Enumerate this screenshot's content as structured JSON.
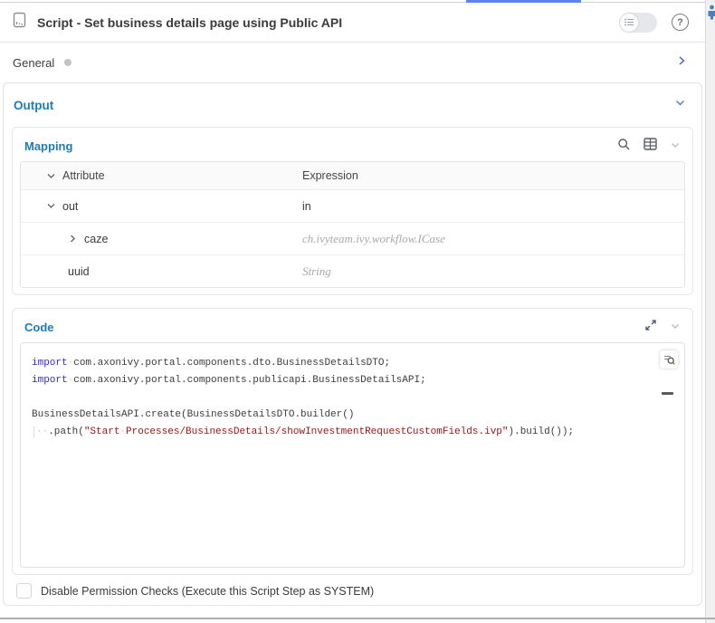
{
  "header": {
    "title": "Script - Set business details page using Public API"
  },
  "general": {
    "label": "General"
  },
  "output": {
    "label": "Output"
  },
  "mapping": {
    "label": "Mapping",
    "columns": {
      "attribute": "Attribute",
      "expression": "Expression"
    },
    "rows": [
      {
        "attribute": "out",
        "expression": "in",
        "chevron": "down",
        "level": 1,
        "placeholder": false
      },
      {
        "attribute": "caze",
        "expression": "ch.ivyteam.ivy.workflow.ICase",
        "chevron": "right",
        "level": 2,
        "placeholder": true
      },
      {
        "attribute": "uuid",
        "expression": "String",
        "chevron": "none",
        "level": 2,
        "placeholder": true
      }
    ]
  },
  "code": {
    "label": "Code",
    "lines": [
      [
        {
          "t": "import",
          "c": "kw"
        },
        {
          "t": "·",
          "c": "ws"
        },
        {
          "t": "com.axonivy.portal.components.dto.BusinessDetailsDTO;",
          "c": "pl"
        }
      ],
      [
        {
          "t": "import",
          "c": "kw"
        },
        {
          "t": "·",
          "c": "ws"
        },
        {
          "t": "com.axonivy.portal.components.publicapi.BusinessDetailsAPI;",
          "c": "pl"
        }
      ],
      [],
      [
        {
          "t": "BusinessDetailsAPI.create(BusinessDetailsDTO.builder()",
          "c": "pl"
        }
      ],
      [
        {
          "t": "··",
          "c": "ws indent"
        },
        {
          "t": ".path(",
          "c": "pl"
        },
        {
          "t": "\"Start",
          "c": "str"
        },
        {
          "t": "·",
          "c": "ws"
        },
        {
          "t": "Processes/BusinessDetails/showInvestmentRequestCustomFields.ivp\"",
          "c": "str"
        },
        {
          "t": ").build());",
          "c": "pl"
        }
      ]
    ]
  },
  "permission": {
    "label": "Disable Permission Checks (Execute this Script Step as SYSTEM)",
    "checked": false
  },
  "colors": {
    "accent": "#1a7cb8",
    "keyword": "#2d2dd4",
    "string": "#a31515",
    "top_bar": "#5b87e8"
  }
}
